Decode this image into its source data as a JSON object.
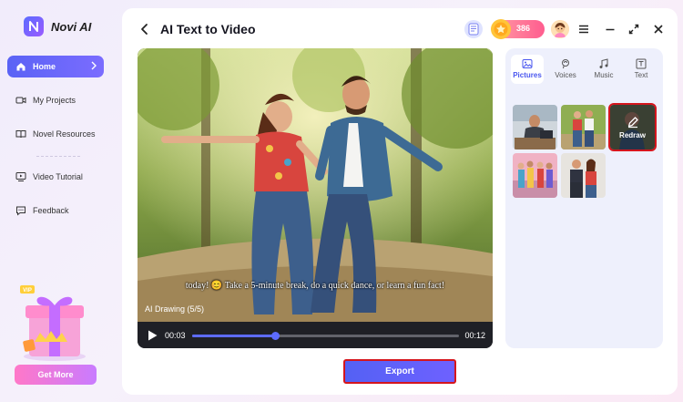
{
  "app": {
    "name": "Novi AI"
  },
  "sidebar": {
    "items": [
      {
        "label": "Home",
        "icon": "home-icon",
        "active": true
      },
      {
        "label": "My Projects",
        "icon": "video-folder-icon"
      },
      {
        "label": "Novel Resources",
        "icon": "book-icon"
      },
      {
        "label": "Video Tutorial",
        "icon": "tutorial-icon"
      },
      {
        "label": "Feedback",
        "icon": "feedback-icon"
      }
    ],
    "promo_button": "Get More"
  },
  "header": {
    "title": "AI Text to Video",
    "coins": "386"
  },
  "player": {
    "subtitle": "today! 😊 Take a 5-minute break, do a quick dance, or learn a fun fact!",
    "caption": "AI Drawing  (5/5)",
    "current_time": "00:03",
    "total_time": "00:12",
    "progress": 0.31
  },
  "panel": {
    "tabs": [
      {
        "label": "Pictures",
        "icon": "picture-icon",
        "active": true
      },
      {
        "label": "Voices",
        "icon": "voice-icon"
      },
      {
        "label": "Music",
        "icon": "music-icon"
      },
      {
        "label": "Text",
        "icon": "text-icon"
      }
    ],
    "thumbnails": [
      {
        "icon": "man-at-desk-image"
      },
      {
        "icon": "couple-walking-image"
      },
      {
        "icon": "man-portrait-image",
        "selected": true
      },
      {
        "icon": "group-dancing-image"
      },
      {
        "icon": "couple-dancing-image"
      }
    ],
    "redraw_label": "Redraw"
  },
  "footer": {
    "export_label": "Export"
  },
  "colors": {
    "accent": "#5a63f5",
    "highlight": "#d5151d",
    "coin": "#ff5d8f"
  }
}
